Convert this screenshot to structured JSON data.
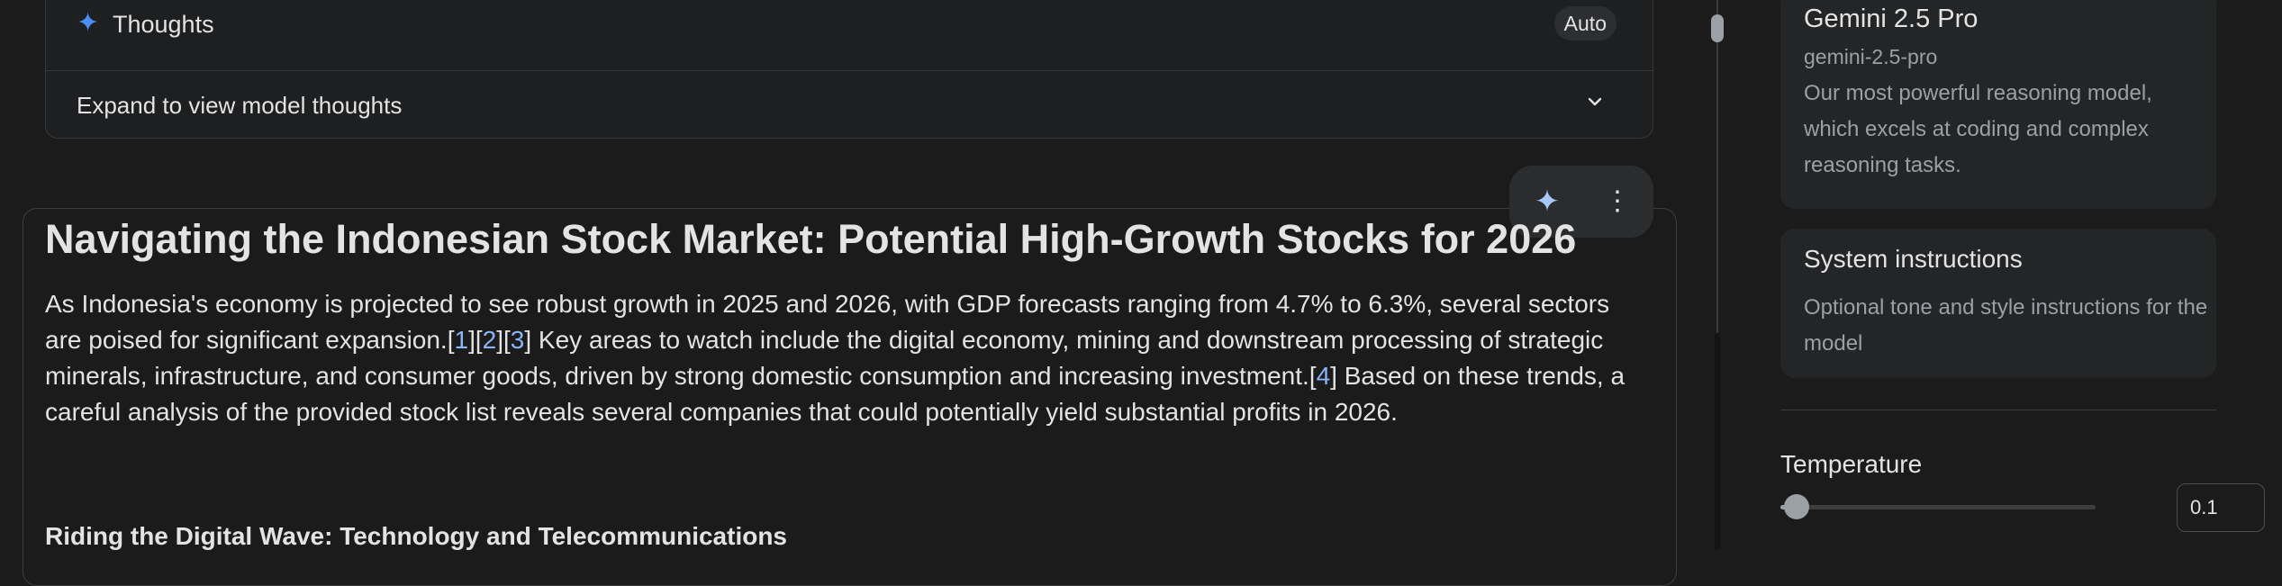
{
  "thoughts": {
    "title": "Thoughts",
    "mode_badge": "Auto",
    "expand_label": "Expand to view model thoughts",
    "icon": "sparkle-icon",
    "chevron": "chevron-down-icon"
  },
  "response": {
    "title": "Navigating the Indonesian Stock Market: Potential High-Growth Stocks for 2026",
    "paragraph": {
      "part1": "As Indonesia's economy is projected to see robust growth in 2025 and 2026, with GDP forecasts ranging from 4.7% to 6.3%, several sectors are poised for significant expansion.",
      "cite1": "1",
      "cite2": "2",
      "cite3": "3",
      "part2": " Key areas to watch include the digital economy, mining and downstream processing of strategic minerals, infrastructure, and consumer goods, driven by strong domestic consumption and increasing investment.",
      "cite4": "4",
      "part3": " Based on these trends, a careful analysis of the provided stock list reveals several companies that could potentially yield substantial profits in 2026."
    },
    "subheading": "Riding the Digital Wave: Technology and Telecommunications",
    "actions": {
      "rerun_icon": "sparkle-icon",
      "more_icon": "more-vert-icon"
    }
  },
  "scrollbar": {
    "position": 0.05
  },
  "settings": {
    "model": {
      "name": "Gemini 2.5 Pro",
      "id": "gemini-2.5-pro",
      "description": "Our most powerful reasoning model, which excels at coding and complex reasoning tasks."
    },
    "system_instructions": {
      "title": "System instructions",
      "description": "Optional tone and style instructions for the model"
    },
    "temperature": {
      "label": "Temperature",
      "value": "0.1",
      "fraction": 0.05
    }
  },
  "colors": {
    "background": "#1b1b1c",
    "accent": "#4c8df6",
    "citation": "#8ab4f8",
    "muted_text": "#9aa0a6"
  }
}
